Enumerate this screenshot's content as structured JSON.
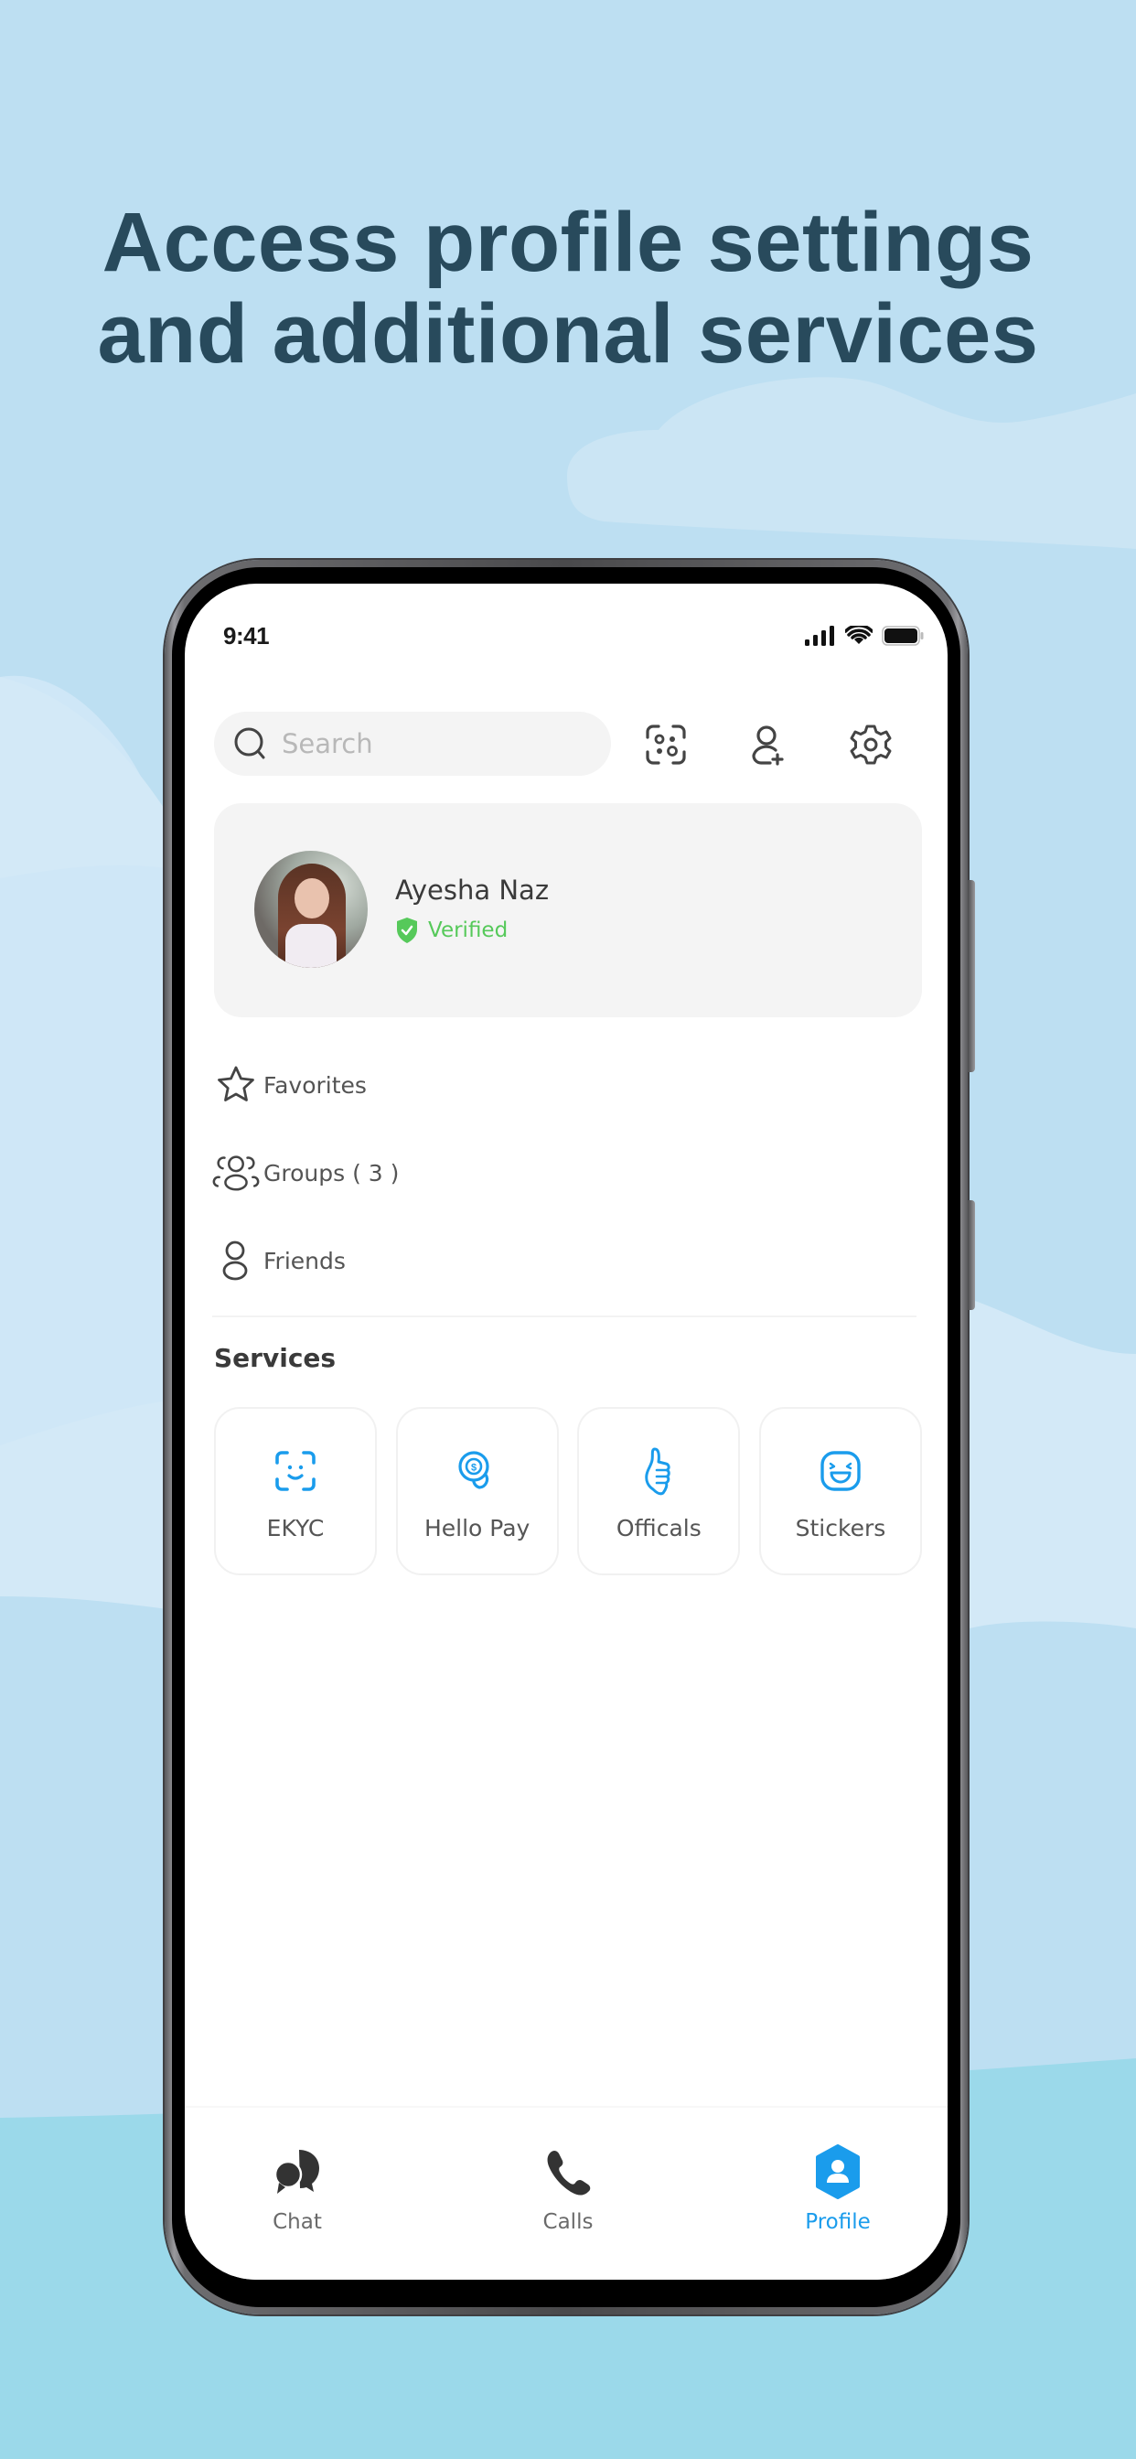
{
  "headline": {
    "line1": "Access profile settings",
    "line2": "and additional services"
  },
  "colors": {
    "background": "#bddff2",
    "background_light": "#d3e9f7",
    "background_bottom": "#9bd9ea",
    "headline": "#284a5c",
    "accent": "#1a9cec",
    "verified": "#56c95a",
    "icon_dark": "#3a3a3a"
  },
  "status_bar": {
    "time": "9:41",
    "icons": [
      "signal-icon",
      "wifi-icon",
      "battery-icon"
    ]
  },
  "top_bar": {
    "search": {
      "placeholder": "Search",
      "value": ""
    },
    "actions": [
      {
        "name": "scan-icon",
        "label": "Scan"
      },
      {
        "name": "add-contact-icon",
        "label": "Add contact"
      },
      {
        "name": "settings-icon",
        "label": "Settings"
      }
    ]
  },
  "profile": {
    "name": "Ayesha Naz",
    "status": "Verified"
  },
  "list": {
    "items": [
      {
        "label": "Favorites",
        "icon": "star-icon"
      },
      {
        "label": "Groups ( 3 )",
        "icon": "group-icon"
      },
      {
        "label": "Friends",
        "icon": "person-icon"
      }
    ]
  },
  "services": {
    "title": "Services",
    "items": [
      {
        "label": "EKYC",
        "icon": "face-scan-icon"
      },
      {
        "label": "Hello Pay",
        "icon": "coin-icon"
      },
      {
        "label": "Officals",
        "icon": "thumbs-up-icon"
      },
      {
        "label": "Stickers",
        "icon": "sticker-icon"
      }
    ]
  },
  "bottom_nav": {
    "items": [
      {
        "label": "Chat",
        "icon": "chat-icon",
        "active": false
      },
      {
        "label": "Calls",
        "icon": "phone-icon",
        "active": false
      },
      {
        "label": "Profile",
        "icon": "profile-icon",
        "active": true
      }
    ]
  }
}
